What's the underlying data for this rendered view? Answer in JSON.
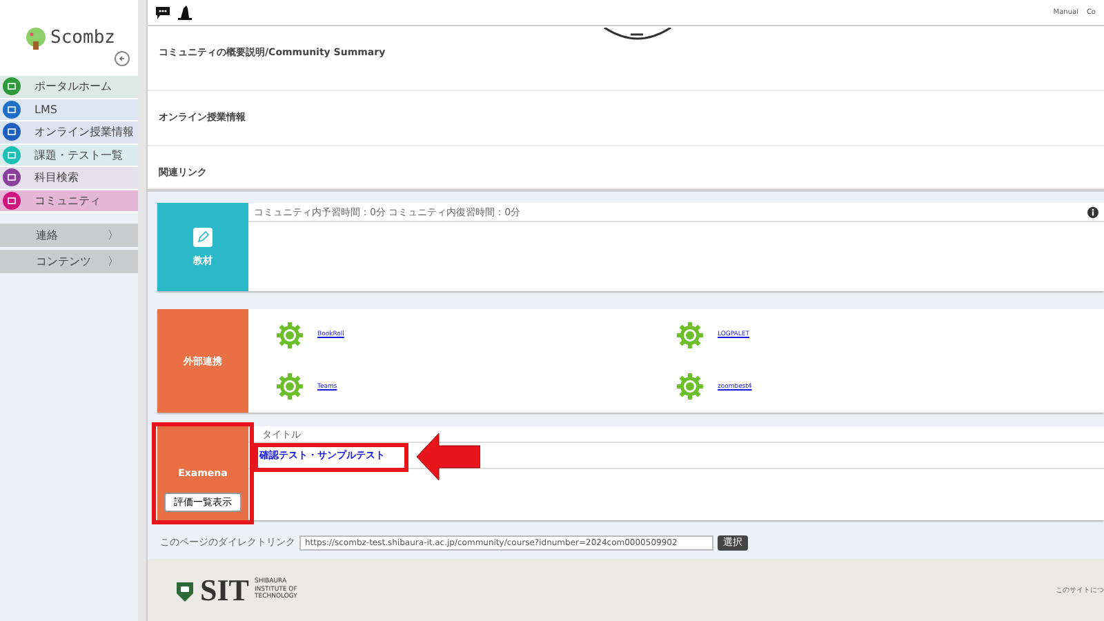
{
  "sidebar": {
    "logo_text": "Scombz",
    "menu": [
      {
        "label": "ポータルホーム",
        "color": "#2e9a3c",
        "selected": false
      },
      {
        "label": "LMS",
        "color": "#1f6fc6",
        "selected": false
      },
      {
        "label": "オンライン授業情報",
        "color": "#1f5fc0",
        "selected": false
      },
      {
        "label": "課題・テスト一覧",
        "color": "#1cbfb3",
        "selected": false
      },
      {
        "label": "科目検索",
        "color": "#8a3f9a",
        "selected": false
      },
      {
        "label": "コミュニティ",
        "color": "#d0157f",
        "selected": true
      }
    ],
    "groups": [
      {
        "label": "連絡",
        "chevron": "〉"
      },
      {
        "label": "コンテンツ",
        "chevron": "〉"
      }
    ]
  },
  "header": {
    "links": [
      "Manual",
      "Co"
    ]
  },
  "sections": [
    "コミュニティの概要説明/Community Summary",
    "オンライン授業情報",
    "関連リンク"
  ],
  "material_card": {
    "title": "教材",
    "info": "コミュニティ内予習時間：0分 コミュニティ内復習時間：0分"
  },
  "external_card": {
    "title": "外部連携",
    "links": [
      "BookRoll",
      "LOGPALET",
      "Teams",
      "zoombest4"
    ]
  },
  "examena_card": {
    "title": "Examena",
    "button": "評価一覧表示",
    "column": "タイトル",
    "tests": [
      "確認テスト・サンプルテスト"
    ]
  },
  "direct_link": {
    "label": "このページのダイレクトリンク",
    "value": "https://scombz-test.shibaura-it.ac.jp/community/course?idnumber=2024com0000509902",
    "button": "選択"
  },
  "footer": {
    "logo": "SIT",
    "institute": "SHIBAURA INSTITUTE OF TECHNOLOGY",
    "right_link": "このサイトにつ"
  }
}
